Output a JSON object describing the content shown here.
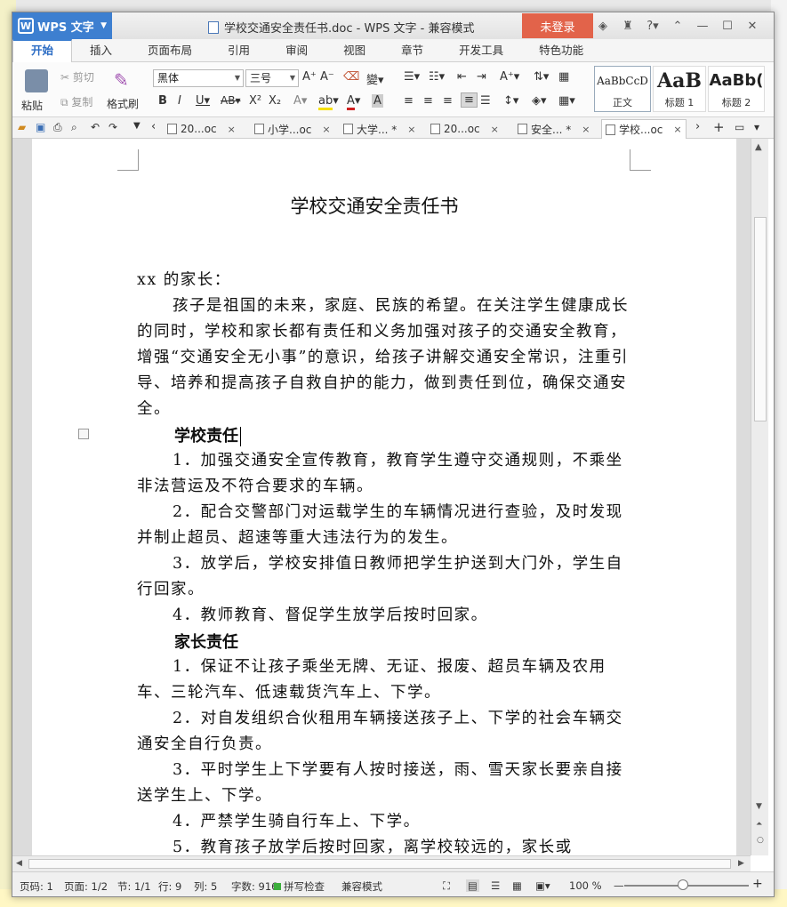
{
  "app": {
    "brand": "WPS 文字",
    "window_title": "学校交通安全责任书.doc - WPS 文字 - 兼容模式",
    "login": "未登录"
  },
  "menu": {
    "tabs": [
      "开始",
      "插入",
      "页面布局",
      "引用",
      "审阅",
      "视图",
      "章节",
      "开发工具",
      "特色功能"
    ],
    "active": "开始"
  },
  "ribbon": {
    "paste": "粘贴",
    "cut": "剪切",
    "copy": "复制",
    "format_painter": "格式刷",
    "font_name": "黑体",
    "font_size": "三号",
    "styles": [
      {
        "preview": "AaBbCcD",
        "name": "正文"
      },
      {
        "preview": "AaB",
        "name": "标题 1"
      },
      {
        "preview": "AaBb(",
        "name": "标题 2"
      }
    ]
  },
  "doc_tabs": [
    {
      "label": "20...oc",
      "close": "×",
      "active": false
    },
    {
      "label": "小学...oc",
      "close": "×",
      "active": false
    },
    {
      "label": "大学... *",
      "close": "×",
      "active": false
    },
    {
      "label": "20...oc",
      "close": "×",
      "active": false
    },
    {
      "label": "安全... *",
      "close": "×",
      "active": false
    },
    {
      "label": "学校...oc",
      "close": "×",
      "active": true
    }
  ],
  "document": {
    "title": "学校交通安全责任书",
    "salutation": "xx 的家长：",
    "intro": "孩子是祖国的未来，家庭、民族的希望。在关注学生健康成长的同时，学校和家长都有责任和义务加强对孩子的交通安全教育，增强“交通安全无小事”的意识，给孩子讲解交通安全常识，注重引导、培养和提高孩子自救自护的能力，做到责任到位，确保交通安全。",
    "school_heading": "学校责任",
    "school_items": [
      "1．加强交通安全宣传教育，教育学生遵守交通规则，不乘坐非法营运及不符合要求的车辆。",
      "2．配合交警部门对运载学生的车辆情况进行查验，及时发现并制止超员、超速等重大违法行为的发生。",
      "3．放学后，学校安排值日教师把学生护送到大门外，学生自行回家。",
      "4．教师教育、督促学生放学后按时回家。"
    ],
    "parent_heading": "家长责任",
    "parent_items": [
      "1．保证不让孩子乘坐无牌、无证、报废、超员车辆及农用车、三轮汽车、低速载货汽车上、下学。",
      "2．对自发组织合伙租用车辆接送孩子上、下学的社会车辆交通安全自行负责。",
      "3．平时学生上下学要有人按时接送，雨、雪天家长要亲自接送学生上、下学。",
      "4．严禁学生骑自行车上、下学。",
      "5．教育孩子放学后按时回家，离学校较远的，家长或"
    ]
  },
  "status": {
    "page_num": "页码: 1",
    "pages": "页面: 1/2",
    "section": "节: 1/1",
    "row": "行: 9",
    "col": "列: 5",
    "wordcount": "字数: 916",
    "spellcheck": "拼写检查",
    "mode": "兼容模式",
    "zoom": "100 %"
  }
}
